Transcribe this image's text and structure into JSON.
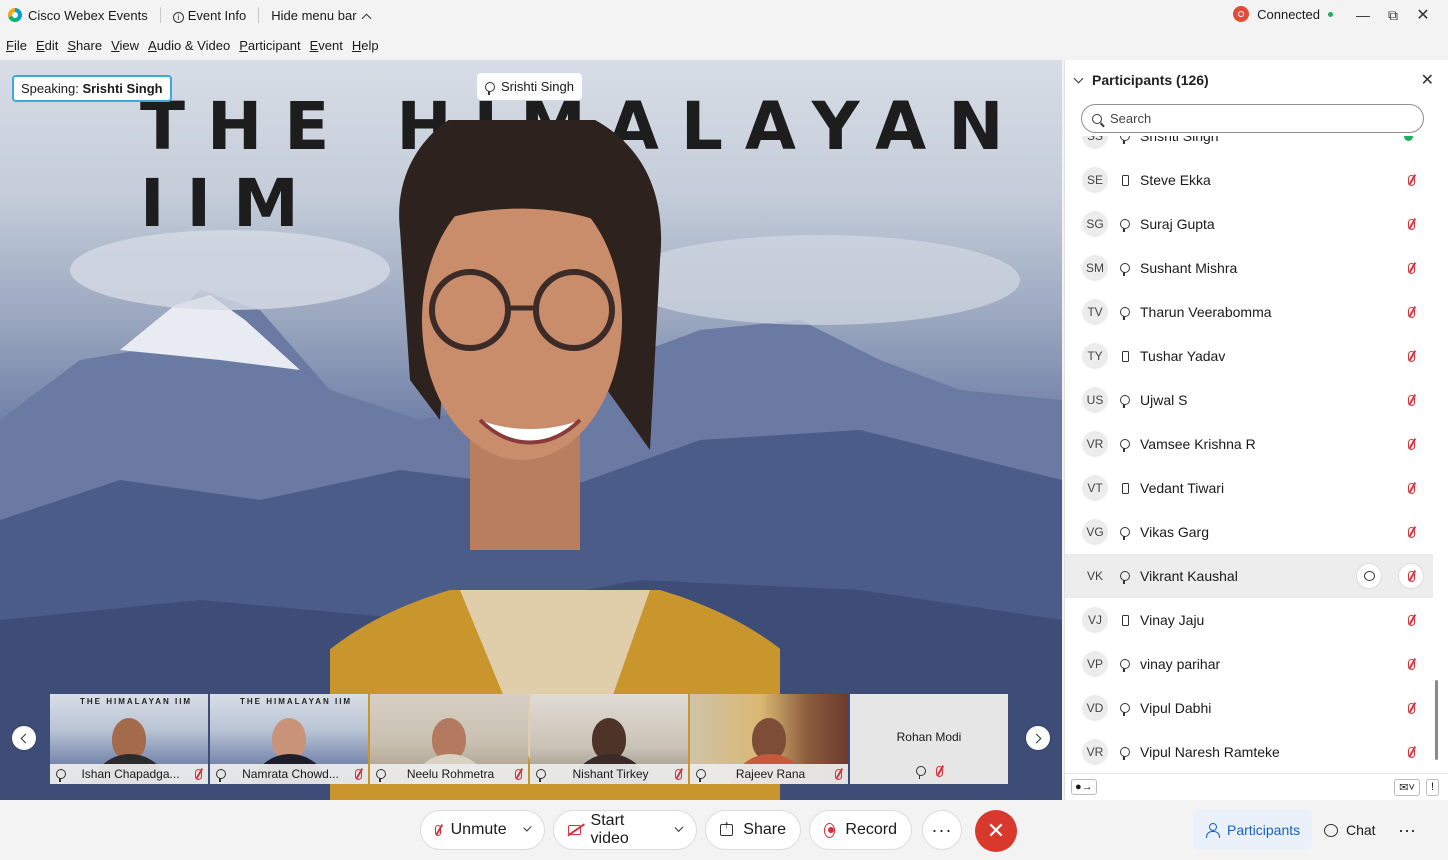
{
  "app": {
    "title": "Cisco Webex Events",
    "event_info": "Event Info",
    "hide_menu": "Hide menu bar",
    "status": "Connected"
  },
  "menu": [
    "File",
    "Edit",
    "Share",
    "View",
    "Audio & Video",
    "Participant",
    "Event",
    "Help"
  ],
  "stage": {
    "speaking_label": "Speaking:",
    "speaking_name": "Srishti Singh",
    "active_name": "Srishti Singh",
    "banner": "THE HIMALAYAN IIM"
  },
  "filmstrip": [
    {
      "name": "Ishan Chapadga...",
      "banner": "THE HIMALAYAN IIM"
    },
    {
      "name": "Namrata Chowd...",
      "banner": "THE HIMALAYAN IIM"
    },
    {
      "name": "Neelu Rohmetra"
    },
    {
      "name": "Nishant Tirkey"
    },
    {
      "name": "Rajeev Rana"
    },
    {
      "name": "Rohan Modi"
    }
  ],
  "participants": {
    "title": "Participants (126)",
    "search_placeholder": "Search",
    "partial_row": {
      "initials": "SS",
      "name": "Srishti Singh"
    },
    "rows": [
      {
        "initials": "SE",
        "name": "Steve Ekka",
        "device": "phone"
      },
      {
        "initials": "SG",
        "name": "Suraj Gupta",
        "device": "headset"
      },
      {
        "initials": "SM",
        "name": "Sushant Mishra",
        "device": "headset"
      },
      {
        "initials": "TV",
        "name": "Tharun Veerabomma",
        "device": "headset"
      },
      {
        "initials": "TY",
        "name": "Tushar Yadav",
        "device": "phone"
      },
      {
        "initials": "US",
        "name": "Ujwal S",
        "device": "headset"
      },
      {
        "initials": "VR",
        "name": "Vamsee Krishna R",
        "device": "headset"
      },
      {
        "initials": "VT",
        "name": "Vedant Tiwari",
        "device": "phone"
      },
      {
        "initials": "VG",
        "name": "Vikas Garg",
        "device": "headset"
      },
      {
        "initials": "VK",
        "name": "Vikrant Kaushal",
        "device": "headset",
        "hovered": true
      },
      {
        "initials": "VJ",
        "name": "Vinay Jaju",
        "device": "phone"
      },
      {
        "initials": "VP",
        "name": "vinay parihar",
        "device": "headset"
      },
      {
        "initials": "VD",
        "name": "Vipul Dabhi",
        "device": "headset"
      },
      {
        "initials": "VR",
        "name": "Vipul Naresh Ramteke",
        "device": "headset"
      }
    ]
  },
  "controls": {
    "unmute": "Unmute",
    "start_video": "Start video",
    "share": "Share",
    "record": "Record",
    "more": "···",
    "participants_tab": "Participants",
    "chat_tab": "Chat",
    "end_color": "#d9382c",
    "accent": "#1862c6"
  }
}
